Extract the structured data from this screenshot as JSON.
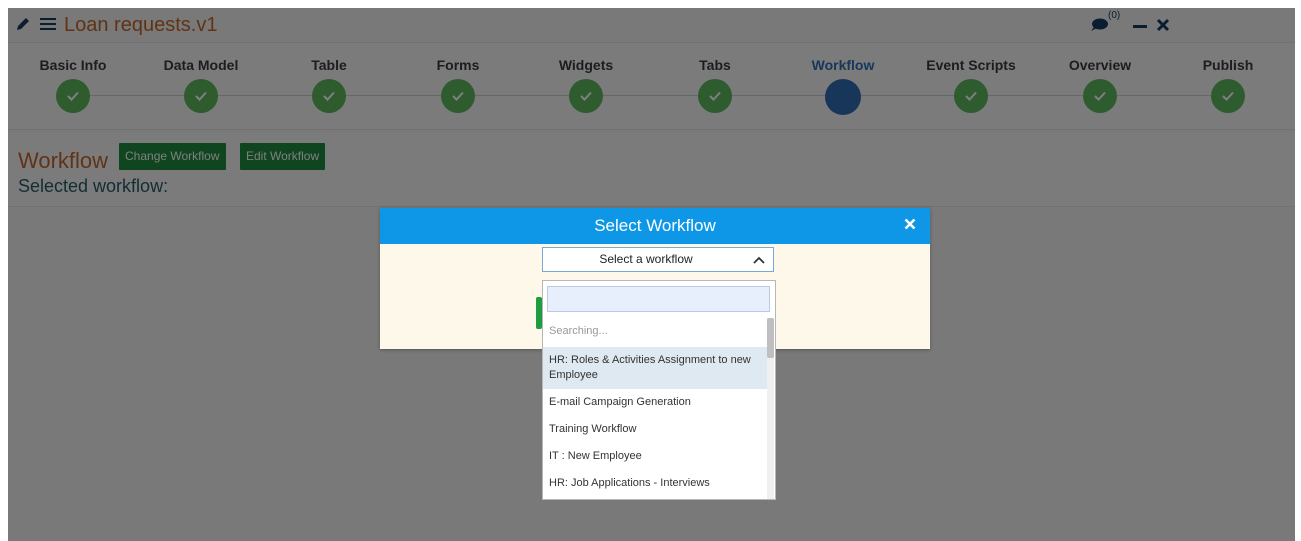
{
  "app": {
    "title": "Loan requests.v1",
    "chat_count": "(0)"
  },
  "wizard": {
    "steps": [
      {
        "label": "Basic Info",
        "state": "done"
      },
      {
        "label": "Data Model",
        "state": "done"
      },
      {
        "label": "Table",
        "state": "done"
      },
      {
        "label": "Forms",
        "state": "done"
      },
      {
        "label": "Widgets",
        "state": "done"
      },
      {
        "label": "Tabs",
        "state": "done"
      },
      {
        "label": "Workflow",
        "state": "active"
      },
      {
        "label": "Event Scripts",
        "state": "done"
      },
      {
        "label": "Overview",
        "state": "done"
      },
      {
        "label": "Publish",
        "state": "done"
      }
    ]
  },
  "panel": {
    "title": "Workflow",
    "change_button": "Change Workflow",
    "edit_button": "Edit Workflow",
    "selected_label": "Selected workflow:"
  },
  "modal": {
    "title": "Select Workflow",
    "select_value": "Select a workflow"
  },
  "dropdown": {
    "search_value": "",
    "status": "Searching...",
    "options": [
      "HR: Roles & Activities Assignment to new Employee",
      "E-mail Campaign Generation",
      "Training Workflow",
      "IT : New Employee",
      "HR: Job Applications - Interviews"
    ]
  },
  "colors": {
    "accent_orange": "#c0662b",
    "done_green": "#5cb85c",
    "active_blue": "#2e6db3",
    "modal_header": "#0d97e6",
    "button_green": "#1e8a3e"
  }
}
